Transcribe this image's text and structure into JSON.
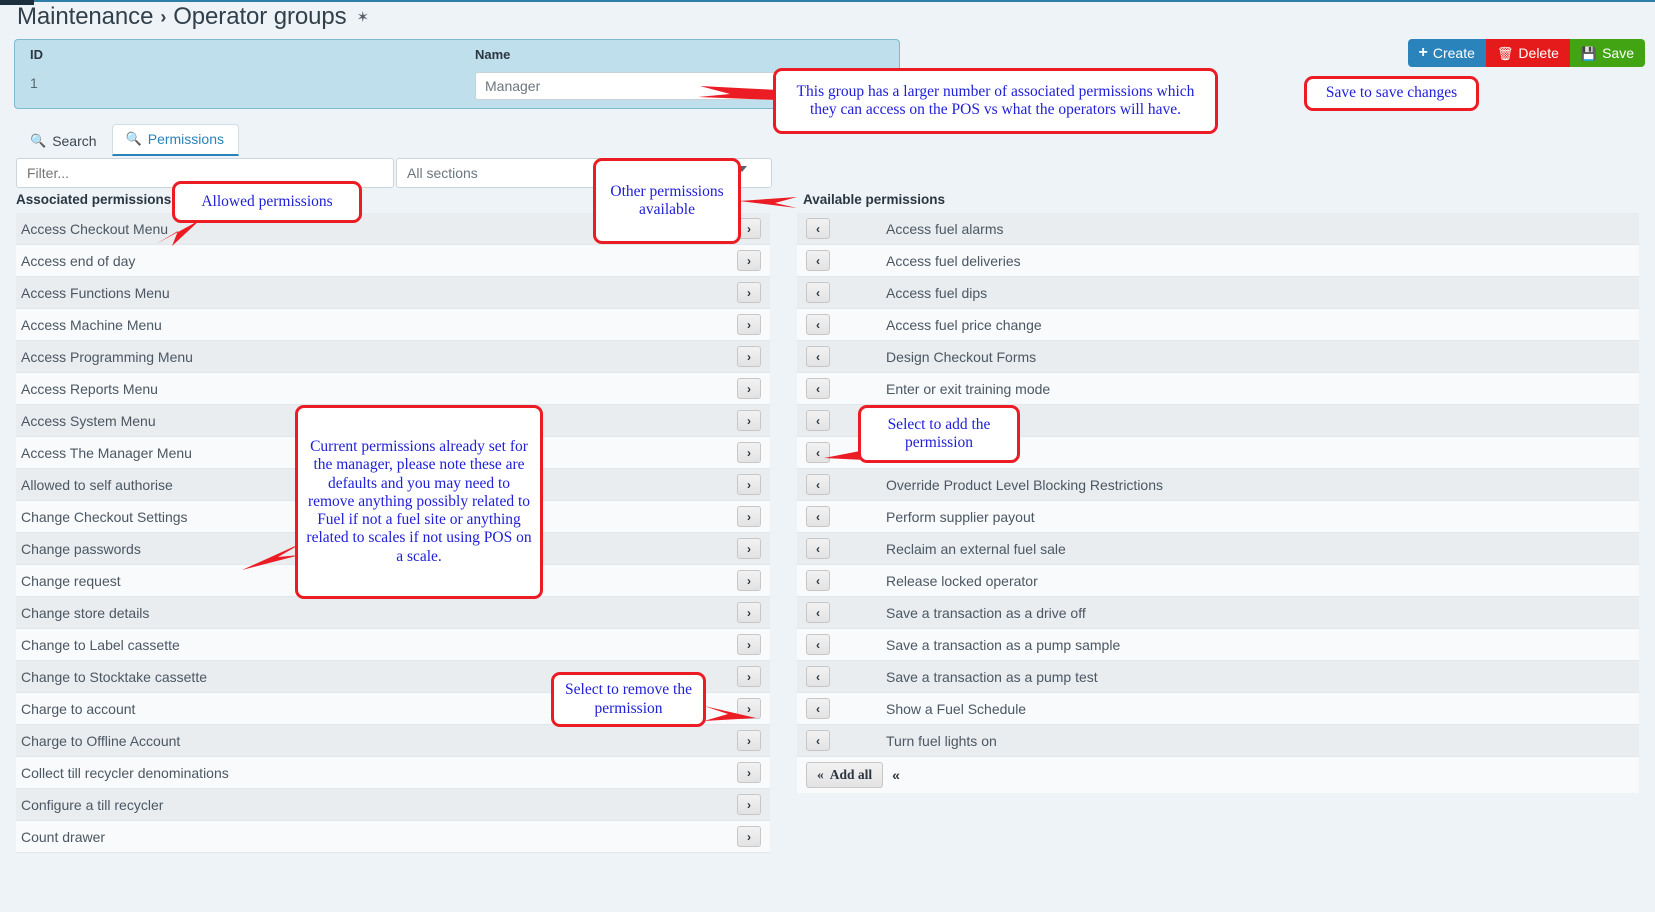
{
  "breadcrumb": {
    "parent": "Maintenance",
    "separator": "›",
    "current": "Operator groups",
    "pin_icon": "✶"
  },
  "record": {
    "id_label": "ID",
    "id_value": "1",
    "name_label": "Name",
    "name_value": "Manager",
    "name_placeholder": "Name"
  },
  "actions": {
    "create_label": "Create",
    "create_icon": "+",
    "delete_label": "Delete",
    "delete_icon": "🗑",
    "save_label": "Save",
    "save_icon": "💾",
    "create_color": "#2a83ba",
    "delete_color": "#e51b1b",
    "save_color": "#42a413"
  },
  "tabs": [
    {
      "label": "Search",
      "icon": "🔍",
      "active": false
    },
    {
      "label": "Permissions",
      "icon": "🔍",
      "active": true
    }
  ],
  "filters": {
    "filter_placeholder": "Filter...",
    "filter_value": "",
    "sections_selected": "All sections",
    "sections_options": [
      "All sections"
    ]
  },
  "associated": {
    "heading": "Associated permissions",
    "move_icon": "›",
    "items": [
      "Access Checkout Menu",
      "Access end of day",
      "Access Functions Menu",
      "Access Machine Menu",
      "Access Programming Menu",
      "Access Reports Menu",
      "Access System Menu",
      "Access The Manager Menu",
      "Allowed to self authorise",
      "Change Checkout Settings",
      "Change passwords",
      "Change request",
      "Change store details",
      "Change to Label cassette",
      "Change to Stocktake cassette",
      "Charge to account",
      "Charge to Offline Account",
      "Collect till recycler denominations",
      "Configure a till recycler",
      "Count drawer"
    ]
  },
  "available": {
    "heading": "Available permissions",
    "move_icon": "‹",
    "items": [
      "Access fuel alarms",
      "Access fuel deliveries",
      "Access fuel dips",
      "Access fuel price change",
      "Design Checkout Forms",
      "Enter or exit training mode",
      "",
      "",
      "Override Product Level Blocking Restrictions",
      "Perform supplier payout",
      "Reclaim an external fuel sale",
      "Release locked operator",
      "Save a transaction as a drive off",
      "Save a transaction as a pump sample",
      "Save a transaction as a pump test",
      "Show a Fuel Schedule",
      "Turn fuel lights on"
    ],
    "add_all_label": "Add all",
    "add_all_icon": "«",
    "add_all_extra_icon": "«"
  },
  "annotations": {
    "group_note": "This group has a larger number of associated permissions which they can access on the POS vs what the operators will have.",
    "save_note": "Save to save changes",
    "allowed_note": "Allowed permissions",
    "other_note": "Other permissions available",
    "current_note": "Current permissions already set for the manager, please note these are defaults and you may need to remove anything possibly related to Fuel if not a fuel site or anything related to scales if not using POS on a scale.",
    "remove_note": "Select to remove the permission",
    "add_note": "Select to add the permission",
    "border_color": "#ec1c24",
    "text_color": "#2020d8"
  }
}
